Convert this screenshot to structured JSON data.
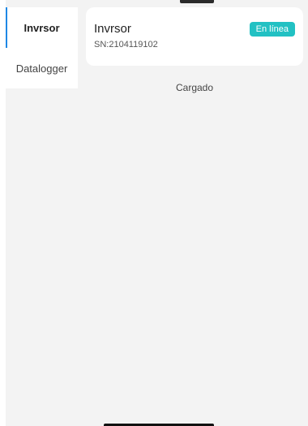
{
  "sidebar": {
    "items": [
      {
        "label": "Invrsor",
        "active": true
      },
      {
        "label": "Datalogger",
        "active": false
      }
    ]
  },
  "device_card": {
    "name": "Invrsor",
    "serial": "SN:2104119102",
    "status_badge": "En línea"
  },
  "status_text": "Cargado",
  "colors": {
    "accent": "#1e88e5",
    "badge": "#22c1c3",
    "background": "#f3f3f3"
  }
}
